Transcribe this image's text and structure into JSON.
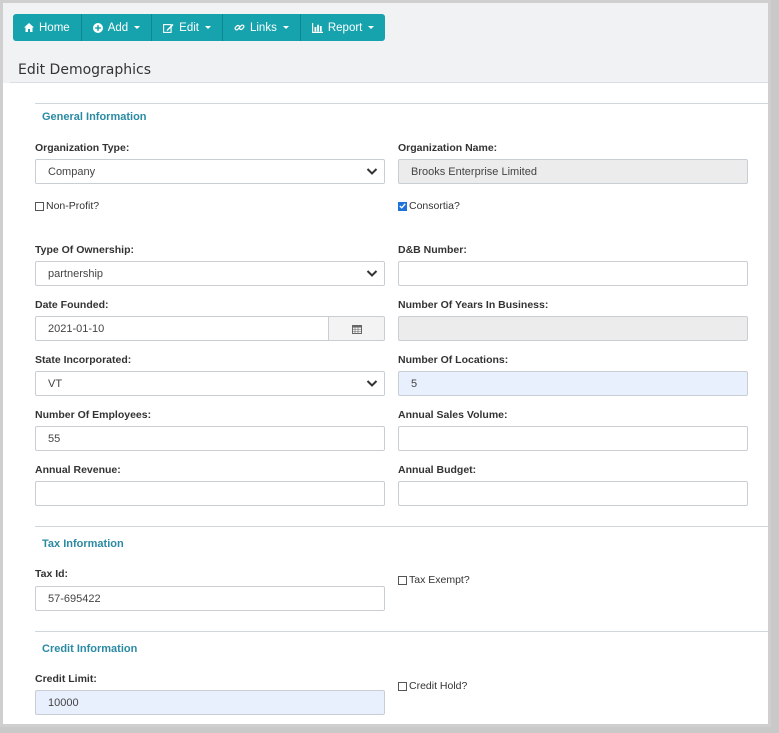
{
  "toolbar": {
    "home": "Home",
    "add": "Add",
    "edit": "Edit",
    "links": "Links",
    "report": "Report"
  },
  "page": {
    "title": "Edit Demographics"
  },
  "general": {
    "heading": "General Information",
    "org_type": {
      "label": "Organization Type:",
      "value": "Company"
    },
    "org_name": {
      "label": "Organization Name:",
      "value": "Brooks Enterprise Limited"
    },
    "non_profit": {
      "label": "Non-Profit?",
      "checked": false
    },
    "consortia": {
      "label": "Consortia?",
      "checked": true
    },
    "ownership": {
      "label": "Type Of Ownership:",
      "value": "partnership"
    },
    "dnb": {
      "label": "D&B Number:",
      "value": ""
    },
    "date_founded": {
      "label": "Date Founded:",
      "value": "2021-01-10"
    },
    "years_in_business": {
      "label": "Number Of Years In Business:",
      "value": ""
    },
    "state": {
      "label": "State Incorporated:",
      "value": "VT"
    },
    "locations": {
      "label": "Number Of Locations:",
      "value": "5"
    },
    "employees": {
      "label": "Number Of Employees:",
      "value": "55"
    },
    "sales_volume": {
      "label": "Annual Sales Volume:",
      "value": ""
    },
    "revenue": {
      "label": "Annual Revenue:",
      "value": ""
    },
    "budget": {
      "label": "Annual Budget:",
      "value": ""
    }
  },
  "tax": {
    "heading": "Tax Information",
    "tax_id": {
      "label": "Tax Id:",
      "value": "57-695422"
    },
    "exempt": {
      "label": "Tax Exempt?",
      "checked": false
    }
  },
  "credit": {
    "heading": "Credit Information",
    "limit": {
      "label": "Credit Limit:",
      "value": "10000"
    },
    "hold": {
      "label": "Credit Hold?",
      "checked": false
    }
  },
  "colors": {
    "toolbar": "#17a3ad",
    "section_heading": "#2a8aa3",
    "autofill": "#e8f0fe"
  }
}
